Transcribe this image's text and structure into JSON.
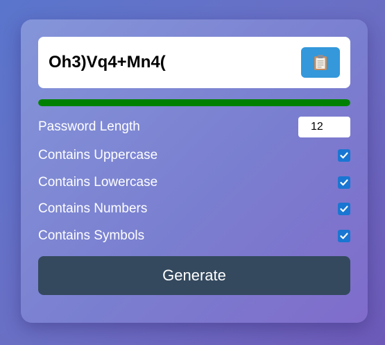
{
  "password": {
    "value": "Oh3)Vq4+Mn4("
  },
  "copy_button": {
    "icon": "clipboard-icon"
  },
  "strength": {
    "level": 1.0,
    "color": "#008000"
  },
  "options": {
    "length_label": "Password Length",
    "length_value": "12",
    "uppercase_label": "Contains Uppercase",
    "uppercase_checked": true,
    "lowercase_label": "Contains Lowercase",
    "lowercase_checked": true,
    "numbers_label": "Contains Numbers",
    "numbers_checked": true,
    "symbols_label": "Contains Symbols",
    "symbols_checked": true
  },
  "generate_button": {
    "label": "Generate",
    "color": "#34495e"
  },
  "colors": {
    "accent": "#3498db",
    "checkbox": "#1976d2"
  }
}
